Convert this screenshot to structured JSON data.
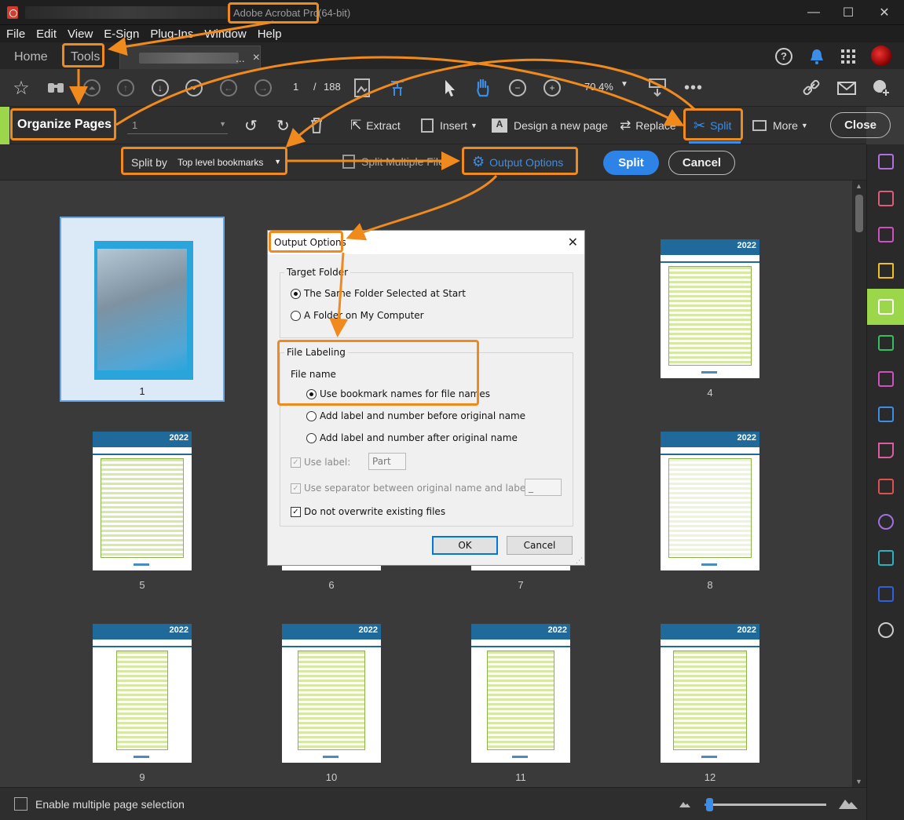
{
  "window": {
    "title": "Adobe Acrobat Pro",
    "title_suffix": "(64-bit)",
    "minimize": "—",
    "maximize": "☐",
    "close": "✕"
  },
  "menu": [
    "File",
    "Edit",
    "View",
    "E-Sign",
    "Plug-Ins",
    "Window",
    "Help"
  ],
  "tabs": {
    "home": "Home",
    "tools": "Tools",
    "doc_ellipsis": "...",
    "doc_close": "×"
  },
  "toolbar": {
    "page_current": "1",
    "page_separator": "/",
    "page_total": "188",
    "zoom": "70.4%"
  },
  "organize": {
    "title": "Organize Pages",
    "page_range": "1",
    "extract": "Extract",
    "insert": "Insert",
    "design": "Design a new page",
    "replace": "Replace",
    "split": "Split",
    "more": "More",
    "close": "Close"
  },
  "splitbar": {
    "split_by_label": "Split by",
    "split_by_value": "Top level bookmarks",
    "split_multiple": "Split Multiple Files",
    "output_options": "Output Options",
    "split_button": "Split",
    "cancel_button": "Cancel"
  },
  "pages": [
    {
      "label": "1"
    },
    {
      "label": "4"
    },
    {
      "label": "5"
    },
    {
      "label": "6"
    },
    {
      "label": "7"
    },
    {
      "label": "8"
    },
    {
      "label": "9"
    },
    {
      "label": "10"
    },
    {
      "label": "11"
    },
    {
      "label": "12"
    }
  ],
  "page_header_year": "2022",
  "dialog": {
    "title": "Output Options",
    "close": "✕",
    "target_folder": "Target Folder",
    "same_folder": "The Same Folder Selected at Start",
    "folder_on_computer": "A Folder on My Computer",
    "file_labeling": "File Labeling",
    "file_name": "File name",
    "use_bookmark_names": "Use bookmark names for file names",
    "add_before": "Add label and number before original name",
    "add_after": "Add label and number after original name",
    "use_label": "Use label:",
    "use_label_value": "Part",
    "use_separator": "Use separator between original name and label:",
    "separator_value": "_",
    "no_overwrite": "Do not overwrite existing files",
    "ok": "OK",
    "cancel": "Cancel"
  },
  "bottom": {
    "enable_multiple": "Enable multiple page selection"
  },
  "colors": {
    "accent_orange": "#f08a1d",
    "split_blue": "#2d83e6",
    "organize_green": "#9bd64b"
  }
}
